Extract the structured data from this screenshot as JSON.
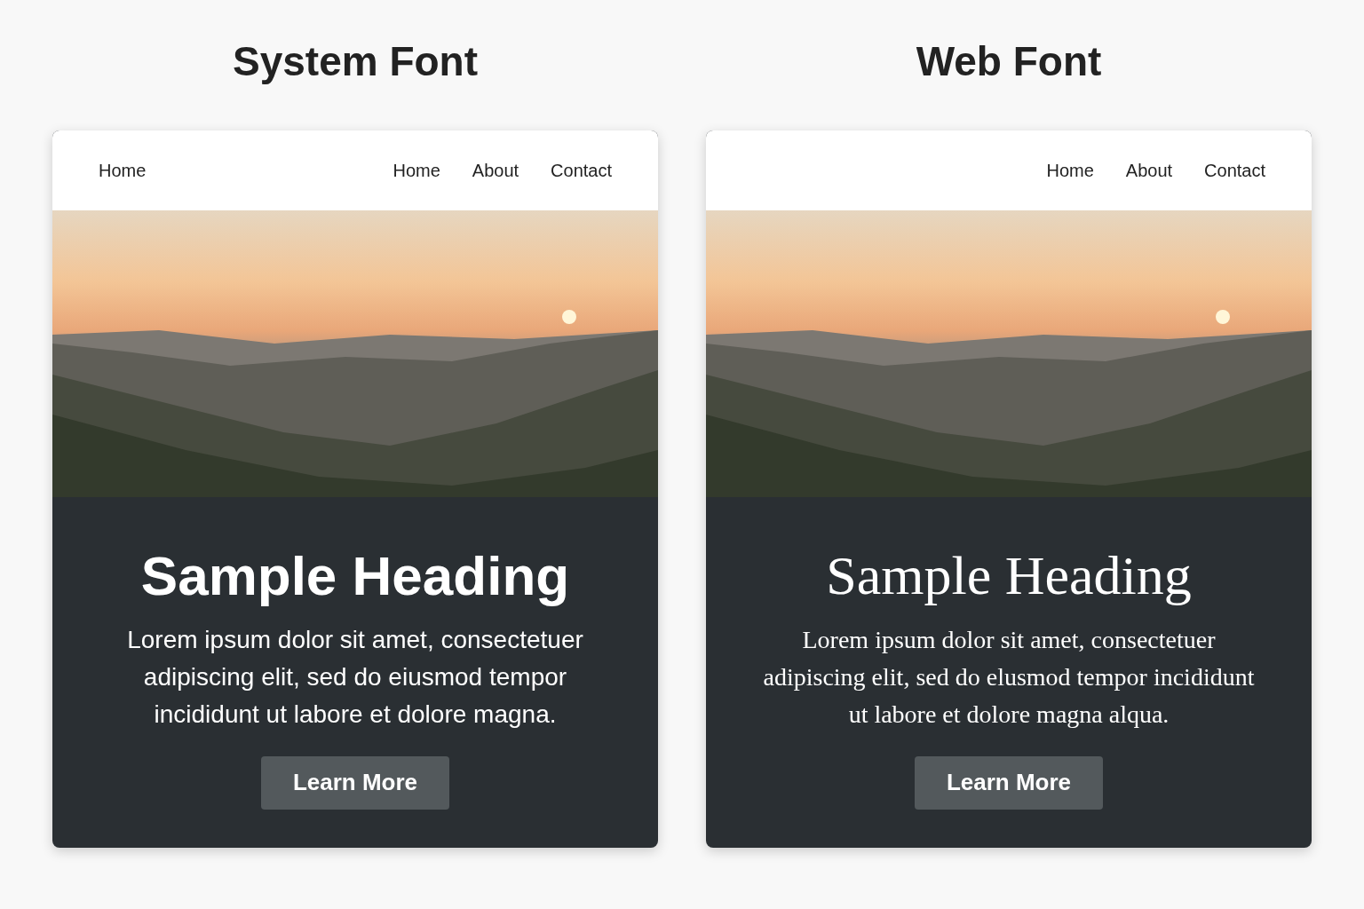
{
  "panels": [
    {
      "kind": "system",
      "title": "System Font",
      "nav": {
        "brand": "Home",
        "links": [
          "Home",
          "About",
          "Contact"
        ]
      },
      "heading": "Sample Heading",
      "paragraph": "Lorem ipsum dolor sit amet, consectetuer adipiscing elit, sed do eiusmod tempor incididunt ut labore et dolore magna.",
      "button": "Learn More"
    },
    {
      "kind": "web",
      "title": "Web Font",
      "nav": {
        "links": [
          "Home",
          "About",
          "Contact"
        ]
      },
      "heading": "Sample Heading",
      "paragraph": "Lorem ipsum dolor sit amet, consectetuer adipiscing elit, sed do elusmod tempor incididunt ut labore et dolore magna alqua.",
      "button": "Learn More"
    }
  ]
}
